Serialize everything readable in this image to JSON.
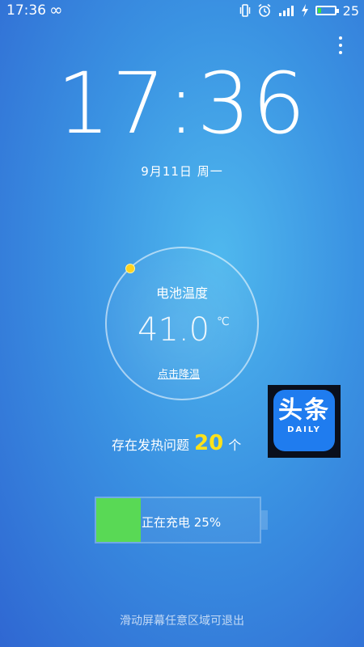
{
  "status_bar": {
    "time": "17:36",
    "loop_icon": "infinity-icon",
    "icons": [
      "vibrate-icon",
      "alarm-icon",
      "signal-icon",
      "charging-icon"
    ],
    "battery_percent_text": "25",
    "battery_level": 0.25
  },
  "clock": {
    "time": "17:36",
    "date": "9月11日 周一"
  },
  "temperature": {
    "label": "电池温度",
    "value": "41.0",
    "unit": "℃",
    "cool_link": "点击降温",
    "dot_color": "#ffd21f"
  },
  "heat_issues": {
    "prefix": "存在发热问题",
    "count": "20",
    "suffix": "个"
  },
  "app_icon": {
    "title": "头条",
    "subtitle": "DAILY",
    "color": "#1f7cef"
  },
  "charging": {
    "text": "正在充电 25%",
    "level": 0.25,
    "fill_color": "#59d955"
  },
  "exit_hint": "滑动屏幕任意区域可退出",
  "colors": {
    "highlight": "#ffe21a",
    "background_top": "#4fb8ee",
    "background_bottom": "#2f67d2"
  }
}
